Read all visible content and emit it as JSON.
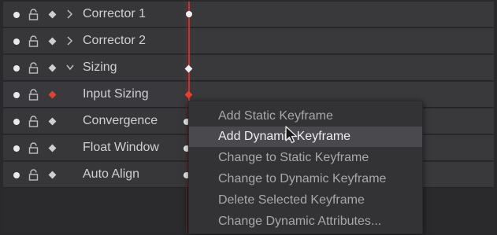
{
  "tracks": [
    {
      "label": "Corrector 1",
      "chevron": "right",
      "keyframe": "dot"
    },
    {
      "label": "Corrector 2",
      "chevron": "right",
      "keyframe": "none"
    },
    {
      "label": "Sizing",
      "chevron": "down",
      "keyframe": "diamond"
    },
    {
      "label": "Input Sizing",
      "chevron": "none",
      "keyframe": "red-diamond"
    },
    {
      "label": "Convergence",
      "chevron": "none",
      "keyframe": "dot"
    },
    {
      "label": "Float Window",
      "chevron": "none",
      "keyframe": "dot"
    },
    {
      "label": "Auto Align",
      "chevron": "none",
      "keyframe": "dot"
    }
  ],
  "context_menu": {
    "items": [
      "Add Static Keyframe",
      "Add Dynamic Keyframe",
      "Change to Static Keyframe",
      "Change to Dynamic Keyframe",
      "Delete Selected Keyframe",
      "Change Dynamic Attributes..."
    ],
    "highlighted_index": 1
  },
  "icons": {
    "enable": "dot-icon",
    "lock": "lock-icon",
    "keyframe": "diamond-icon",
    "expand": "chevron-icon",
    "cursor": "mouse-pointer-icon"
  },
  "colors": {
    "playhead": "#c23434",
    "active_keyframe": "#e0432f",
    "menu_highlight": "#4a4a4e"
  }
}
